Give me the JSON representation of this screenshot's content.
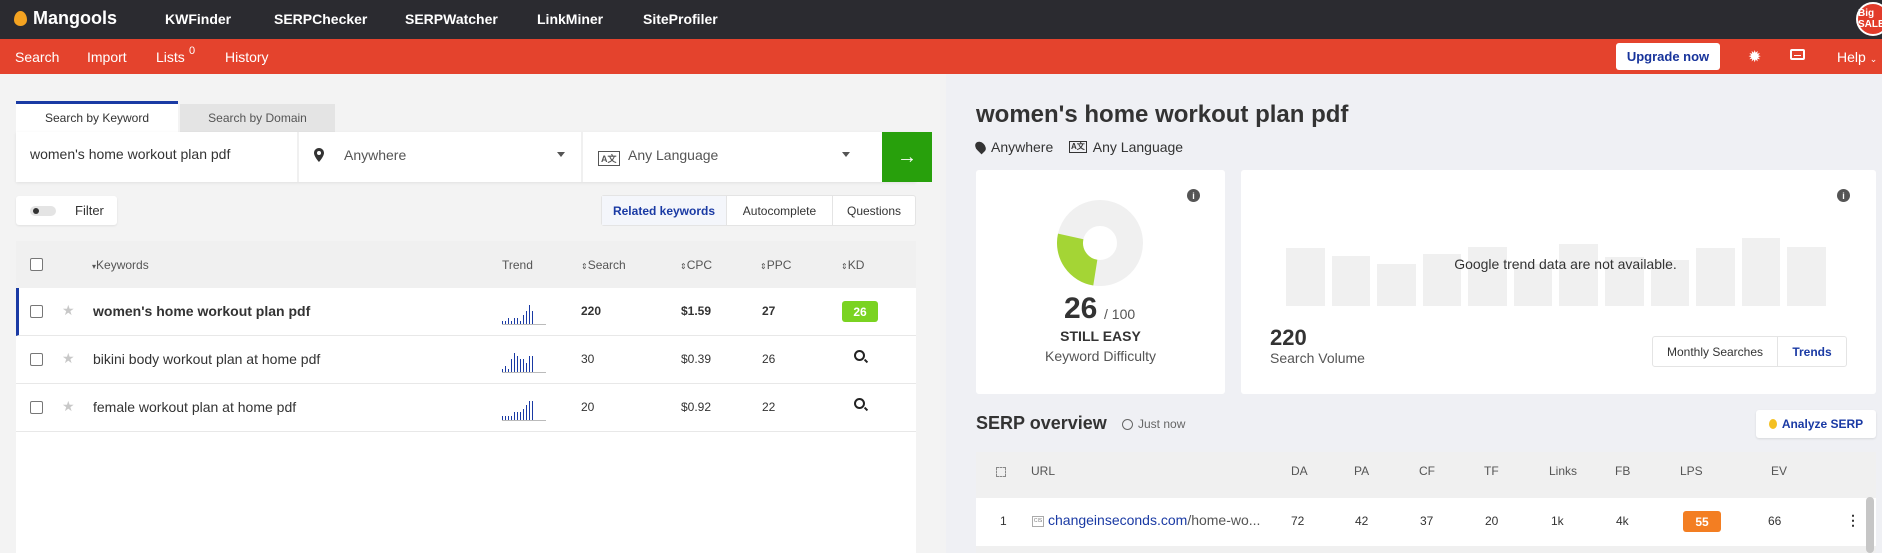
{
  "topbar": {
    "logo": "Mangools",
    "nav": [
      "KWFinder",
      "SERPChecker",
      "SERPWatcher",
      "LinkMiner",
      "SiteProfiler"
    ],
    "avatar_text": "Big SALE"
  },
  "subbar": {
    "nav": [
      "Search",
      "Import",
      "Lists",
      "History"
    ],
    "lists_count": "0",
    "upgrade_label": "Upgrade now",
    "help_label": "Help"
  },
  "search": {
    "tabs": [
      "Search by Keyword",
      "Search by Domain"
    ],
    "keyword": "women's home workout plan pdf",
    "location": "Anywhere",
    "language": "Any Language"
  },
  "filter": {
    "label": "Filter"
  },
  "keyword_tabs": [
    "Related keywords",
    "Autocomplete",
    "Questions"
  ],
  "table": {
    "headers": [
      "Keywords",
      "Trend",
      "Search",
      "CPC",
      "PPC",
      "KD"
    ],
    "rows": [
      {
        "keyword": "women's home workout plan pdf",
        "search": "220",
        "cpc": "$1.59",
        "ppc": "27",
        "kd": "26",
        "trend": [
          1,
          1,
          2,
          1,
          2,
          2,
          1,
          3,
          4,
          6,
          4
        ],
        "active": true
      },
      {
        "keyword": "bikini body workout plan at home pdf",
        "search": "30",
        "cpc": "$0.39",
        "ppc": "26",
        "kd": "",
        "trend": [
          1,
          2,
          1,
          4,
          6,
          5,
          4,
          4,
          3,
          5,
          5
        ],
        "active": false
      },
      {
        "keyword": "female workout plan at home pdf",
        "search": "20",
        "cpc": "$0.92",
        "ppc": "22",
        "kd": "",
        "trend": [
          1,
          1,
          1,
          1,
          2,
          2,
          2,
          3,
          4,
          5,
          5
        ],
        "active": false
      }
    ]
  },
  "detail": {
    "title": "women's home workout plan pdf",
    "location": "Anywhere",
    "language": "Any Language",
    "kd_value": "26",
    "kd_max": "/ 100",
    "kd_level": "STILL EASY",
    "kd_label": "Keyword Difficulty",
    "kd_fraction": 0.26,
    "trend_message": "Google trend data are not available.",
    "search_volume": "220",
    "search_volume_label": "Search Volume",
    "volume_tabs": [
      "Monthly Searches",
      "Trends"
    ]
  },
  "serp": {
    "title": "SERP overview",
    "time": "Just now",
    "analyze_label": "Analyze SERP",
    "headers": [
      "URL",
      "DA",
      "PA",
      "CF",
      "TF",
      "Links",
      "FB",
      "LPS",
      "EV"
    ],
    "row": {
      "rank": "1",
      "domain": "changeinseconds.com",
      "path": "/home-wo...",
      "favicon_text": "CIS",
      "da": "72",
      "pa": "42",
      "cf": "37",
      "tf": "20",
      "links": "1k",
      "fb": "4k",
      "lps": "55",
      "ev": "66"
    }
  },
  "colors": {
    "brand_red": "#e4432d",
    "accent_blue": "#1a3aa4",
    "go_green": "#28a00c",
    "kd_easy": "#7ad321",
    "lps_orange": "#f37e22"
  }
}
